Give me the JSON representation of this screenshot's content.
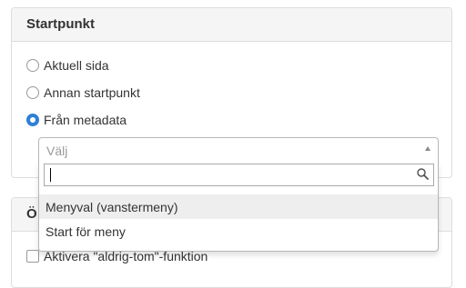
{
  "startpunkt": {
    "title": "Startpunkt",
    "options": [
      {
        "label": "Aktuell sida",
        "checked": false
      },
      {
        "label": "Annan startpunkt",
        "checked": false
      },
      {
        "label": "Från metadata",
        "checked": true
      }
    ],
    "select": {
      "placeholder": "Välj",
      "search_value": "",
      "options": [
        "Menyval (vanstermeny)",
        "Start för meny"
      ],
      "highlighted_index": 0
    }
  },
  "second_panel": {
    "title_partial": "Ö",
    "checkbox_label": "Aktivera \"aldrig-tom\"-funktion",
    "checkbox_checked": false
  },
  "colors": {
    "accent": "#2f7fd7",
    "panel_header_bg": "#f5f5f5",
    "border": "#dddddd",
    "highlight": "#eeeeee"
  },
  "icons": {
    "search": "search-icon",
    "arrow": "chevron-up-icon"
  }
}
